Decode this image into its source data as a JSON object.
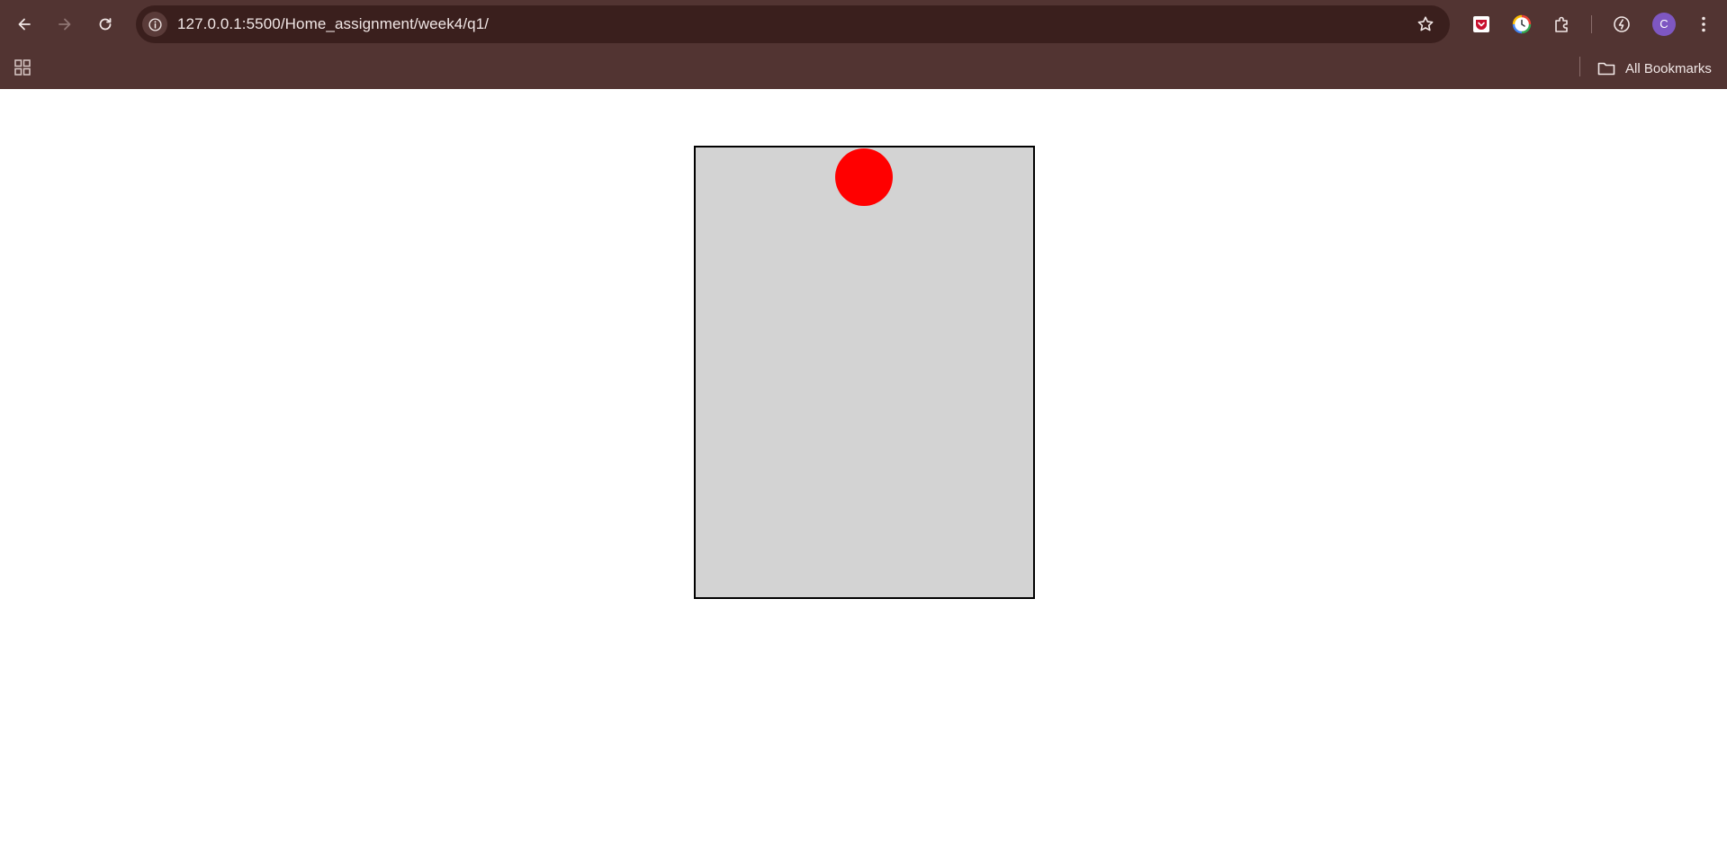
{
  "browser": {
    "url": "127.0.0.1:5500/Home_assignment/week4/q1/",
    "profile_initial": "C",
    "bookmarks_folder": "All Bookmarks",
    "icons": {
      "back": "arrow-left-icon",
      "forward": "arrow-right-icon",
      "reload": "reload-icon",
      "site_info": "info-icon",
      "bookmark_star": "star-icon",
      "extensions": [
        "pocket-icon",
        "clock-extension-icon",
        "puzzle-icon",
        "performance-icon"
      ],
      "menu": "kebab-menu-icon",
      "apps": "apps-grid-icon",
      "folder": "folder-icon"
    },
    "colors": {
      "frame": "#523432",
      "omnibox": "#3a1f1d",
      "avatar": "#7e57c2"
    }
  },
  "page": {
    "container_color": "#d3d3d3",
    "ball_color": "#ff0000"
  }
}
